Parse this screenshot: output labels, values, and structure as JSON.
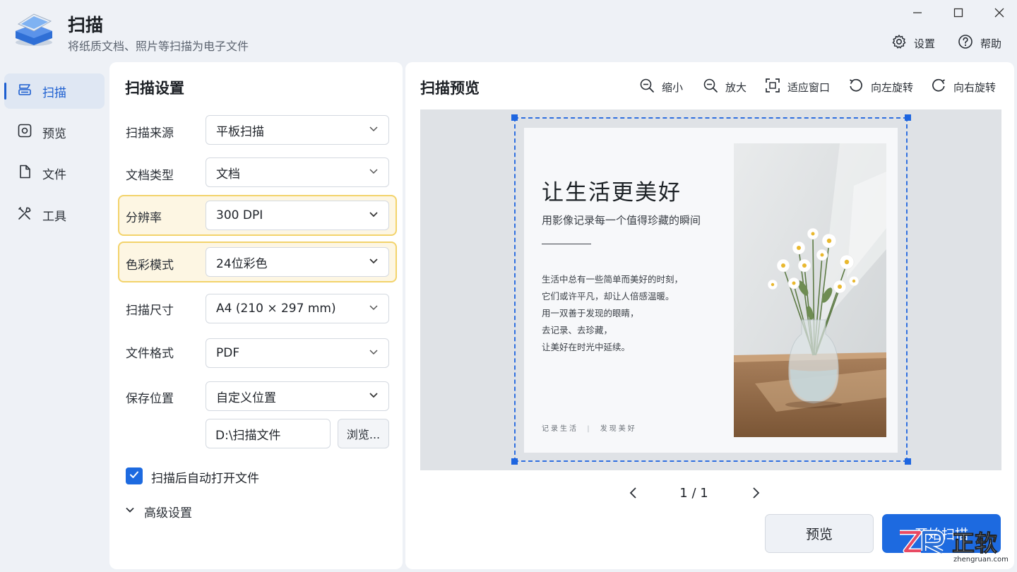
{
  "app": {
    "title": "扫描",
    "subtitle": "将纸质文档、照片等扫描为电子文件",
    "icon": "scanner-icon"
  },
  "window_controls": {
    "minimize": "minimize-icon",
    "maximize": "maximize-icon",
    "close": "close-icon"
  },
  "top_actions": {
    "settings_label": "设置",
    "help_label": "帮助"
  },
  "sidebar": {
    "items": [
      {
        "label": "扫描",
        "icon": "scan-icon",
        "active": true
      },
      {
        "label": "预览",
        "icon": "preview-icon",
        "active": false
      },
      {
        "label": "文件",
        "icon": "file-icon",
        "active": false
      },
      {
        "label": "工具",
        "icon": "tools-icon",
        "active": false
      }
    ]
  },
  "settings": {
    "title": "扫描设置",
    "source": {
      "label": "扫描来源",
      "value": "平板扫描"
    },
    "doc_type": {
      "label": "文档类型",
      "value": "文档"
    },
    "resolution": {
      "label": "分辨率",
      "value": "300 DPI"
    },
    "color_mode": {
      "label": "色彩模式",
      "value": "24位彩色"
    },
    "scan_size": {
      "label": "扫描尺寸",
      "value": "A4 (210 × 297 mm)"
    },
    "file_format": {
      "label": "文件格式",
      "value": "PDF"
    },
    "save_location": {
      "label": "保存位置",
      "value": "自定义位置",
      "path": "D:\\扫描文件",
      "browse_label": "浏览..."
    },
    "auto_open": {
      "label": "扫描后自动打开文件",
      "checked": true
    },
    "advanced_label": "高级设置"
  },
  "preview": {
    "title": "扫描预览",
    "tools": {
      "zoom_out": "缩小",
      "zoom_in": "放大",
      "fit": "适应窗口",
      "rotate_left": "向左旋转",
      "rotate_right": "向右旋转"
    },
    "document": {
      "title": "让生活更美好",
      "subtitle": "用影像记录每一个值得珍藏的瞬间",
      "body": [
        "生活中总有一些简单而美好的时刻，",
        "它们或许平凡，却让人倍感温暖。",
        "用一双善于发现的眼睛，",
        "去记录、去珍藏，",
        "让美好在时光中延续。"
      ],
      "footer_left": "记录生活",
      "footer_right": "发现美好"
    },
    "page_indicator": "1 / 1"
  },
  "actions": {
    "preview_label": "预览",
    "start_label": "开始扫描"
  },
  "colors": {
    "accent": "#1d6ae0",
    "highlight_bg": "#fdf6e3",
    "highlight_border": "#f3d36b"
  },
  "watermark": {
    "brand": "正软",
    "url": "zhengruan.com"
  }
}
